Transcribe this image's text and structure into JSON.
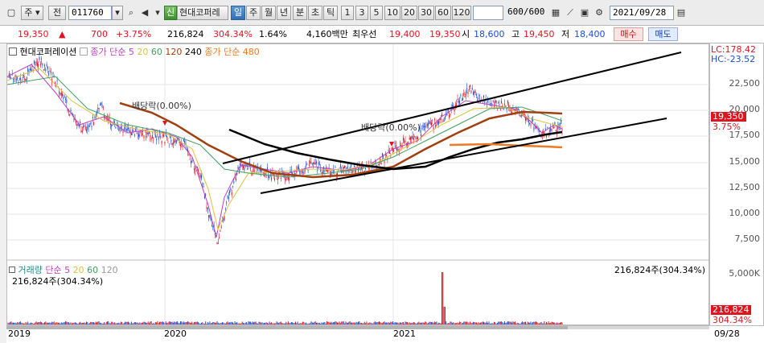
{
  "toolbar": {
    "market_mode": "주",
    "prev_label": "전",
    "stock_code": "011760",
    "shin_badge": "신",
    "stock_name": "현대코퍼레",
    "periods": [
      "일",
      "주",
      "월",
      "년",
      "분",
      "초",
      "틱"
    ],
    "active_period": "일",
    "intervals": [
      "1",
      "3",
      "5",
      "10",
      "20",
      "30",
      "60",
      "120"
    ],
    "count_value": "600",
    "count_total": "/600",
    "date": "2021/09/28"
  },
  "quote": {
    "price": "19,350",
    "change_arrow": "▲",
    "change": "700",
    "change_pct": "+3.75%",
    "volume": "216,824",
    "volume_ratio": "304.34%",
    "turnover": "1.64%",
    "trade_amount": "4,160백만",
    "best_bid_label": "최우선",
    "best_ask": "19,400",
    "best_bid": "19,350",
    "open_label": "시",
    "open": "18,600",
    "high_label": "고",
    "high": "19,450",
    "low_label": "저",
    "low": "18,400",
    "buy_label": "매수",
    "sell_label": "매도"
  },
  "price_panel": {
    "title": "현대코퍼레이션",
    "ma_label": "종가 단순",
    "ma_periods": [
      "5",
      "20",
      "60",
      "120",
      "240"
    ],
    "ma480_label": "종가 단순 480",
    "lc_label": "LC:178.42",
    "hc_label": "HC:-23.52",
    "annotation1": "배당락(0.00%)",
    "annotation2": "배당락(0.00%)",
    "current_price_tag": "19,350",
    "current_pct_tag": "3.75%",
    "y_ticks": [
      "22,500",
      "20,000",
      "17,500",
      "15,000",
      "12,500",
      "10,000",
      "7,500"
    ]
  },
  "volume_panel": {
    "title": "거래량",
    "ma_label": "단순",
    "ma_periods": [
      "5",
      "20",
      "60",
      "120"
    ],
    "left_value": "216,824주(304.34%)",
    "right_value": "216,824주(304.34%)",
    "y_tick": "5,000K",
    "current_tag": "216,824",
    "current_pct_tag": "304.34%"
  },
  "x_axis": {
    "labels": [
      "2019",
      "2020",
      "2021"
    ],
    "last_date": "09/28"
  },
  "colors": {
    "ma5": "#c040c0",
    "ma20": "#e0c040",
    "ma60": "#40a060",
    "ma120": "#a04010",
    "ma240": "#000000",
    "ma480": "#f07820",
    "up": "#e0141e",
    "down": "#1a4fd6"
  }
}
